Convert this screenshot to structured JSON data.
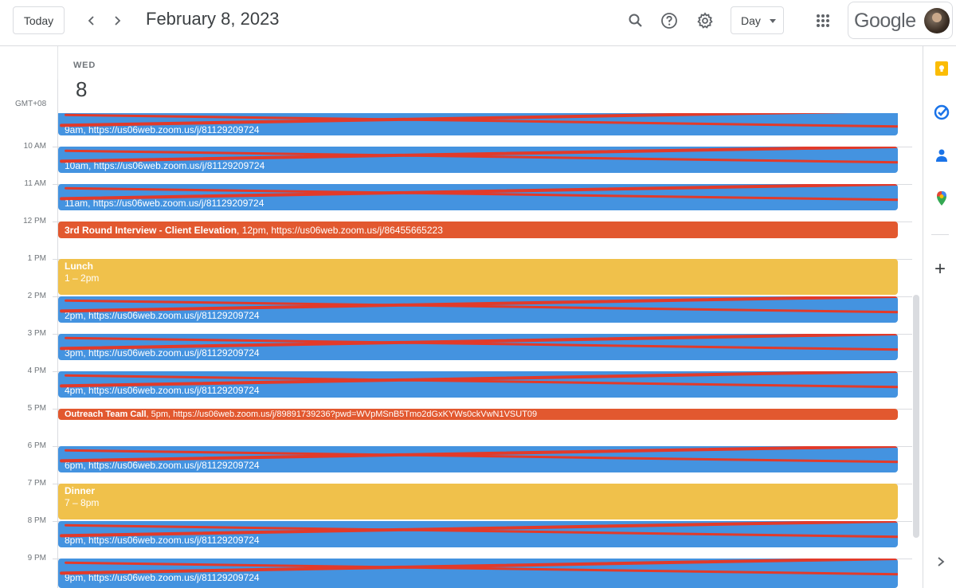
{
  "header": {
    "today_label": "Today",
    "date_title": "February 8, 2023",
    "view_label": "Day",
    "logo_text": "Google",
    "icons": [
      "chevron-left-icon",
      "chevron-right-icon",
      "search-icon",
      "help-icon",
      "settings-icon",
      "apps-icon"
    ]
  },
  "day": {
    "name": "WED",
    "number": "8",
    "timezone": "GMT+08"
  },
  "hours": [
    "10 AM",
    "11 AM",
    "12 PM",
    "1 PM",
    "2 PM",
    "3 PM",
    "4 PM",
    "5 PM",
    "6 PM",
    "7 PM",
    "8 PM",
    "9 PM"
  ],
  "events": [
    {
      "title": "",
      "detail": "9am, https://us06web.zoom.us/j/81129209724",
      "color": "blue",
      "redacted": true
    },
    {
      "title": "",
      "detail": "10am, https://us06web.zoom.us/j/81129209724",
      "color": "blue",
      "redacted": true
    },
    {
      "title": "",
      "detail": "11am, https://us06web.zoom.us/j/81129209724",
      "color": "blue",
      "redacted": true
    },
    {
      "title": "3rd Round Interview - Client Elevation",
      "detail": ", 12pm, https://us06web.zoom.us/j/86455665223",
      "color": "red",
      "redacted": false
    },
    {
      "title": "Lunch",
      "detail": "1 – 2pm",
      "color": "yellow",
      "redacted": false
    },
    {
      "title": "",
      "detail": "2pm, https://us06web.zoom.us/j/81129209724",
      "color": "blue",
      "redacted": true
    },
    {
      "title": "",
      "detail": "3pm, https://us06web.zoom.us/j/81129209724",
      "color": "blue",
      "redacted": true
    },
    {
      "title": "",
      "detail": "4pm, https://us06web.zoom.us/j/81129209724",
      "color": "blue",
      "redacted": true
    },
    {
      "title": "Outreach Team Call",
      "detail": ", 5pm, https://us06web.zoom.us/j/89891739236?pwd=WVpMSnB5Tmo2dGxKYWs0ckVwN1VSUT09",
      "color": "red",
      "redacted": false
    },
    {
      "title": "",
      "detail": "6pm, https://us06web.zoom.us/j/81129209724",
      "color": "blue",
      "redacted": true
    },
    {
      "title": "Dinner",
      "detail": "7 – 8pm",
      "color": "yellow",
      "redacted": false
    },
    {
      "title": "",
      "detail": "8pm, https://us06web.zoom.us/j/81129209724",
      "color": "blue",
      "redacted": true
    },
    {
      "title": "",
      "detail": "9pm, https://us06web.zoom.us/j/81129209724",
      "color": "blue",
      "redacted": true
    }
  ],
  "colors": {
    "blue": "#4493e0",
    "red": "#e2582f",
    "yellow": "#f0c14b"
  },
  "side_panel": {
    "icons": [
      "keep-icon",
      "tasks-icon",
      "contacts-icon",
      "maps-icon",
      "add-icon",
      "expand-icon"
    ]
  }
}
